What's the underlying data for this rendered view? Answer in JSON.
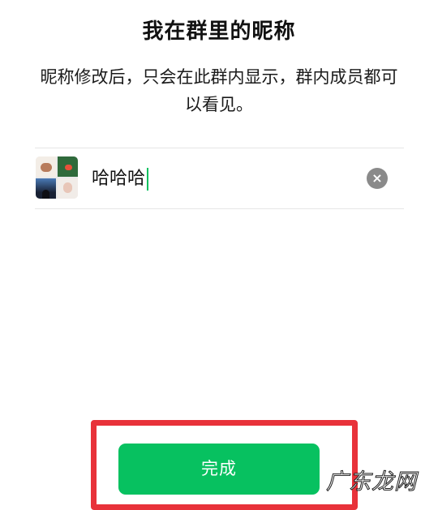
{
  "header": {
    "title": "我在群里的昵称",
    "description": "昵称修改后，只会在此群内显示，群内成员都可以看见。"
  },
  "nickname": {
    "value": "哈哈哈",
    "clear_icon": "×"
  },
  "footer": {
    "done_label": "完成"
  },
  "watermark": {
    "text": "广东龙网"
  },
  "colors": {
    "accent": "#07c160",
    "highlight": "#e8323a"
  }
}
